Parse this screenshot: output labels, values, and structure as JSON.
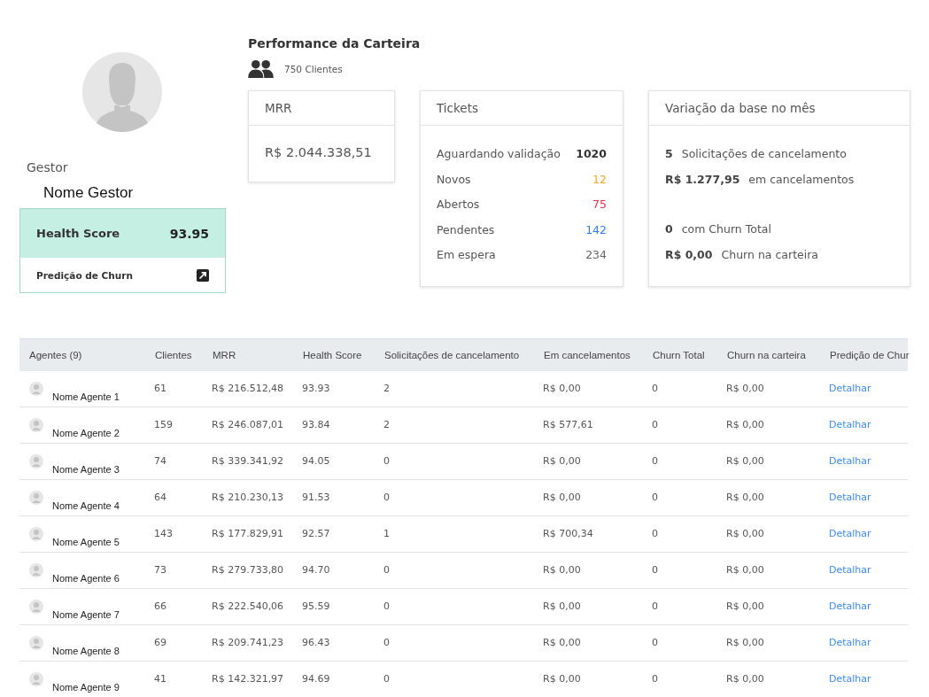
{
  "profile": {
    "role": "Gestor",
    "name": "Nome Gestor",
    "health_score": {
      "label": "Health Score",
      "value": "93.95"
    },
    "churn_link": "Predição de Churn"
  },
  "performance": {
    "title": "Performance da Carteira",
    "clients": "750 Clientes"
  },
  "mrr_card": {
    "title": "MRR",
    "value": "R$ 2.044.338,51"
  },
  "tickets_card": {
    "title": "Tickets",
    "items": [
      {
        "label": "Aguardando validação",
        "value": "1020",
        "color": "#333333"
      },
      {
        "label": "Novos",
        "value": "12",
        "color": "#f5a623"
      },
      {
        "label": "Abertos",
        "value": "75",
        "color": "#e0314b"
      },
      {
        "label": "Pendentes",
        "value": "142",
        "color": "#2f7df6"
      },
      {
        "label": "Em espera",
        "value": "234",
        "color": "#666666"
      }
    ]
  },
  "variation_card": {
    "title": "Variação da base no mês",
    "groups": [
      [
        {
          "value": "5",
          "label": "Solicitações de cancelamento"
        },
        {
          "value": "R$ 1.277,95",
          "label": "em cancelamentos"
        }
      ],
      [
        {
          "value": "0",
          "label": "com Churn Total"
        },
        {
          "value": "R$ 0,00",
          "label": "Churn na carteira"
        }
      ]
    ]
  },
  "table": {
    "columns": [
      "Agentes (9)",
      "Clientes",
      "MRR",
      "Health Score",
      "Solicitações de cancelamento",
      "Em cancelamentos",
      "Churn Total",
      "Churn na carteira",
      "Predição de Chur"
    ],
    "rows": [
      {
        "agent": "Nome Agente 1",
        "clientes": "61",
        "mrr": "R$ 216.512,48",
        "health_score": "93.93",
        "solicitacoes": "2",
        "em_cancelamentos": "R$ 0,00",
        "churn_total": "0",
        "churn_carteira": "R$ 0,00",
        "link": "Detalhar"
      },
      {
        "agent": "Nome Agente 2",
        "clientes": "159",
        "mrr": "R$ 246.087,01",
        "health_score": "93.84",
        "solicitacoes": "2",
        "em_cancelamentos": "R$ 577,61",
        "churn_total": "0",
        "churn_carteira": "R$ 0,00",
        "link": "Detalhar"
      },
      {
        "agent": "Nome Agente 3",
        "clientes": "74",
        "mrr": "R$ 339.341,92",
        "health_score": "94.05",
        "solicitacoes": "0",
        "em_cancelamentos": "R$ 0,00",
        "churn_total": "0",
        "churn_carteira": "R$ 0,00",
        "link": "Detalhar"
      },
      {
        "agent": "Nome Agente 4",
        "clientes": "64",
        "mrr": "R$ 210.230,13",
        "health_score": "91.53",
        "solicitacoes": "0",
        "em_cancelamentos": "R$ 0,00",
        "churn_total": "0",
        "churn_carteira": "R$ 0,00",
        "link": "Detalhar"
      },
      {
        "agent": "Nome Agente 5",
        "clientes": "143",
        "mrr": "R$ 177.829,91",
        "health_score": "92.57",
        "solicitacoes": "1",
        "em_cancelamentos": "R$ 700,34",
        "churn_total": "0",
        "churn_carteira": "R$ 0,00",
        "link": "Detalhar"
      },
      {
        "agent": "Nome Agente 6",
        "clientes": "73",
        "mrr": "R$ 279.733,80",
        "health_score": "94.70",
        "solicitacoes": "0",
        "em_cancelamentos": "R$ 0,00",
        "churn_total": "0",
        "churn_carteira": "R$ 0,00",
        "link": "Detalhar"
      },
      {
        "agent": "Nome Agente 7",
        "clientes": "66",
        "mrr": "R$ 222.540,06",
        "health_score": "95.59",
        "solicitacoes": "0",
        "em_cancelamentos": "R$ 0,00",
        "churn_total": "0",
        "churn_carteira": "R$ 0,00",
        "link": "Detalhar"
      },
      {
        "agent": "Nome Agente 8",
        "clientes": "69",
        "mrr": "R$ 209.741,23",
        "health_score": "96.43",
        "solicitacoes": "0",
        "em_cancelamentos": "R$ 0,00",
        "churn_total": "0",
        "churn_carteira": "R$ 0,00",
        "link": "Detalhar"
      },
      {
        "agent": "Nome Agente 9",
        "clientes": "41",
        "mrr": "R$ 142.321,97",
        "health_score": "94.69",
        "solicitacoes": "0",
        "em_cancelamentos": "R$ 0,00",
        "churn_total": "0",
        "churn_carteira": "R$ 0,00",
        "link": "Detalhar"
      }
    ]
  }
}
